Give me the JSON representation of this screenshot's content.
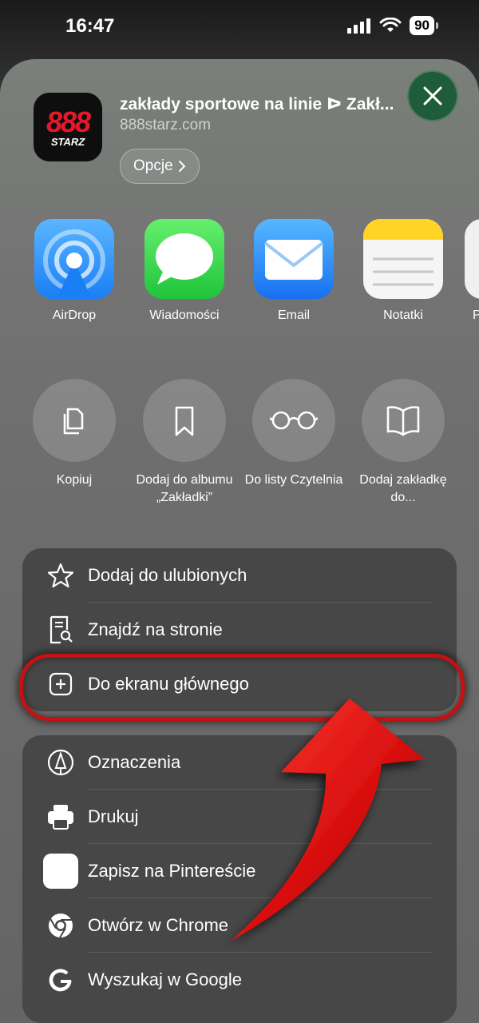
{
  "status_bar": {
    "time": "16:47",
    "battery": "90"
  },
  "share_sheet": {
    "title": "zakłady sportowe na linie ᐅ Zakł...",
    "url": "888starz.com",
    "options_label": "Opcje",
    "app_icon": {
      "number": "888",
      "text": "STARZ",
      "brand_color": "#e3192b"
    },
    "close_icon": "close-icon"
  },
  "apps": [
    {
      "label": "AirDrop",
      "icon": "airdrop-icon"
    },
    {
      "label": "Wiadomości",
      "icon": "messages-icon"
    },
    {
      "label": "Email",
      "icon": "mail-icon"
    },
    {
      "label": "Notatki",
      "icon": "notes-icon"
    },
    {
      "label": "P",
      "icon": "partial-app-icon"
    }
  ],
  "actions": [
    {
      "label": "Kopiuj",
      "icon": "copy-icon"
    },
    {
      "label": "Dodaj do albumu „Zakładki”",
      "icon": "bookmark-icon"
    },
    {
      "label": "Do listy Czytelnia",
      "icon": "glasses-icon"
    },
    {
      "label": "Dodaj zakładkę do...",
      "icon": "book-icon"
    }
  ],
  "list1": [
    {
      "label": "Dodaj do ulubionych",
      "icon": "star-icon"
    },
    {
      "label": "Znajdź na stronie",
      "icon": "find-on-page-icon"
    },
    {
      "label": "Do ekranu głównego",
      "icon": "add-square-icon",
      "highlighted": true
    }
  ],
  "list2": [
    {
      "label": "Oznaczenia",
      "icon": "markup-icon"
    },
    {
      "label": "Drukuj",
      "icon": "printer-icon"
    },
    {
      "label": "Zapisz na Pintereście",
      "icon": "pinterest-icon"
    },
    {
      "label": "Otwórz w Chrome",
      "icon": "chrome-icon"
    },
    {
      "label": "Wyszukaj w Google",
      "icon": "google-icon"
    }
  ],
  "colors": {
    "highlight": "#c41111",
    "arrow": "#e01010"
  }
}
